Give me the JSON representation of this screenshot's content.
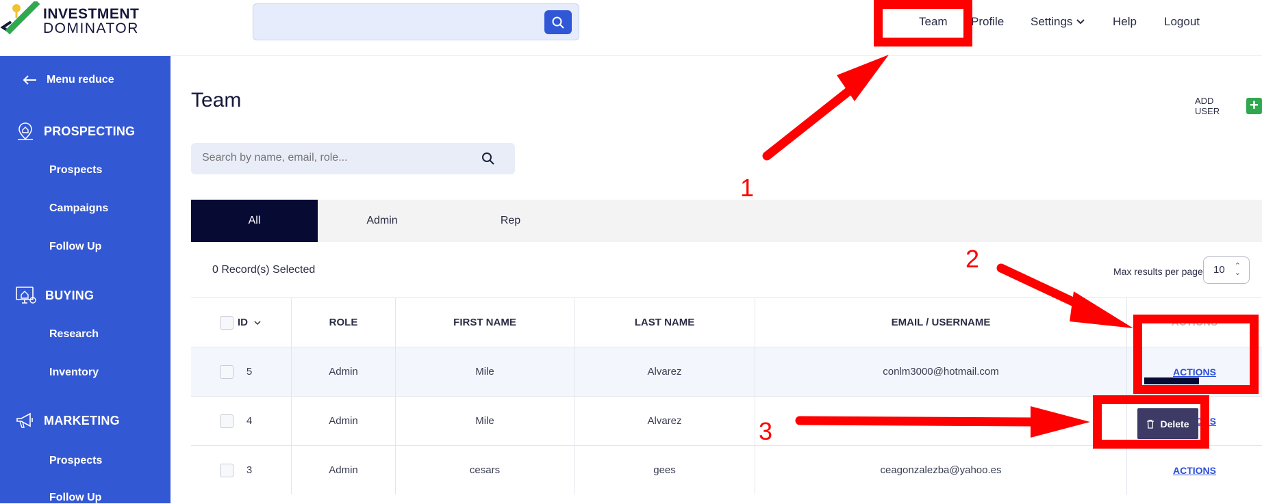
{
  "header": {
    "logo_line1": "INVESTMENT",
    "logo_line2": "DOMINATOR",
    "search_placeholder": "",
    "nav": [
      "Team",
      "Profile",
      "Settings",
      "Help",
      "Logout"
    ]
  },
  "sidebar": {
    "menu_reduce": "Menu reduce",
    "sections": [
      {
        "title": "PROSPECTING",
        "icon": "house-location-icon",
        "items": [
          "Prospects",
          "Campaigns",
          "Follow Up"
        ]
      },
      {
        "title": "BUYING",
        "icon": "house-monitor-icon",
        "items": [
          "Research",
          "Inventory"
        ]
      },
      {
        "title": "MARKETING",
        "icon": "megaphone-icon",
        "items": [
          "Prospects",
          "Follow Up"
        ]
      }
    ]
  },
  "main": {
    "title": "Team",
    "add_user": "ADD USER",
    "search_placeholder": "Search by name, email, role...",
    "tabs": [
      "All",
      "Admin",
      "Rep"
    ],
    "records_selected": "0 Record(s) Selected",
    "max_results_label": "Max results per page",
    "max_results_value": "10",
    "columns": [
      "ID",
      "ROLE",
      "FIRST NAME",
      "LAST NAME",
      "EMAIL / USERNAME",
      "ACTIONS"
    ],
    "rows": [
      {
        "id": "5",
        "role": "Admin",
        "first": "Mile",
        "last": "Alvarez",
        "email": "conlm3000@hotmail.com",
        "action": "ACTIONS"
      },
      {
        "id": "4",
        "role": "Admin",
        "first": "Mile",
        "last": "Alvarez",
        "email": "",
        "action": "ACTIONS"
      },
      {
        "id": "3",
        "role": "Admin",
        "first": "cesars",
        "last": "gees",
        "email": "ceagonzalezba@yahoo.es",
        "action": "ACTIONS"
      }
    ],
    "delete_label": "Delete"
  },
  "annotations": {
    "numbers": [
      "1",
      "2",
      "3"
    ],
    "color": "#ff0000"
  }
}
